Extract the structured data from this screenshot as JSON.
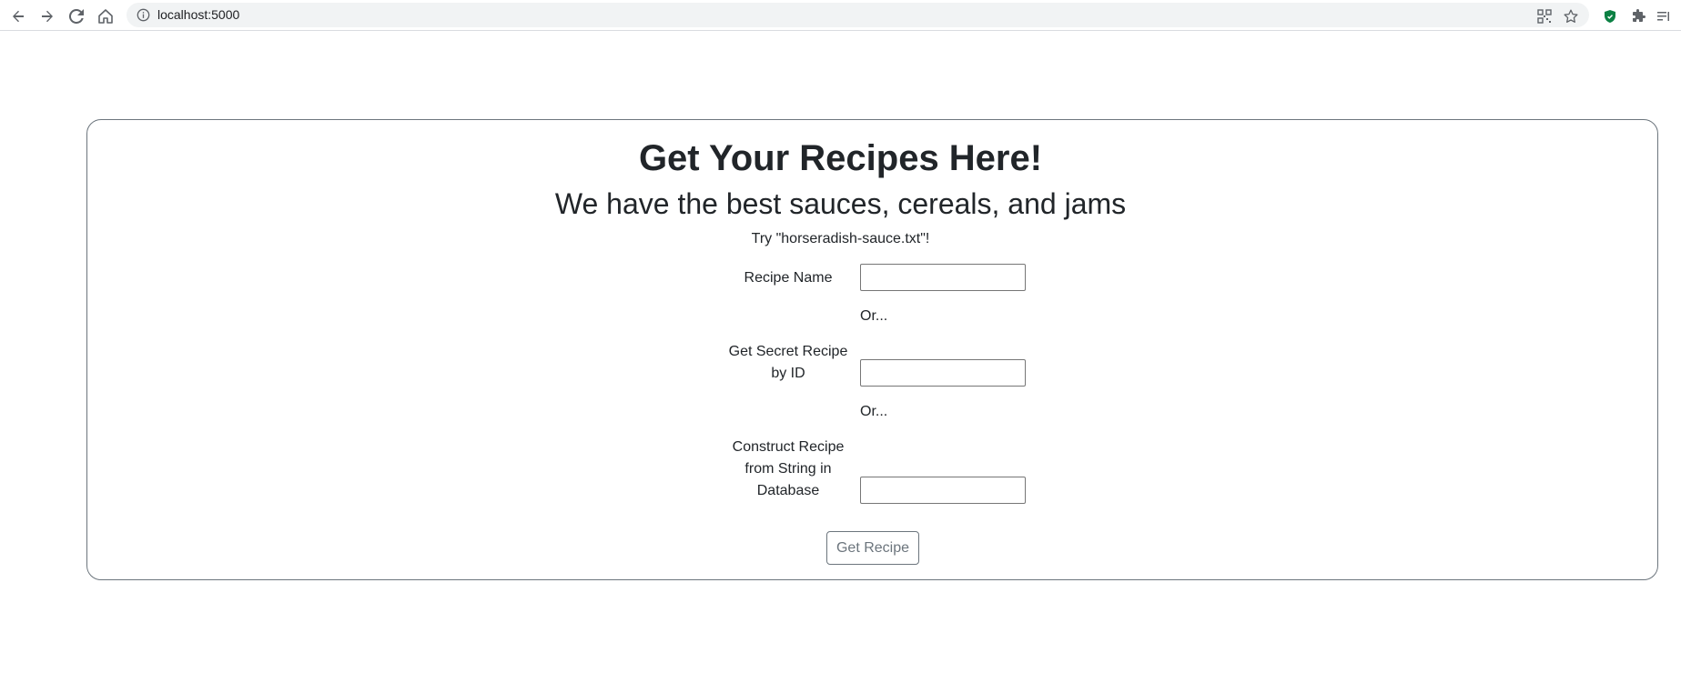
{
  "browser": {
    "url": "localhost:5000",
    "icons": {
      "back": "arrow-left-icon",
      "forward": "arrow-right-icon",
      "reload": "reload-icon",
      "home": "home-icon",
      "site_info": "info-icon",
      "qr": "qr-code-icon",
      "bookmark": "star-icon",
      "extension_shield": "shield-icon",
      "extensions": "puzzle-icon",
      "reading_list": "reading-list-icon"
    }
  },
  "page": {
    "title": "Get Your Recipes Here!",
    "subtitle": "We have the best sauces, cereals, and jams",
    "hint": "Try \"horseradish-sauce.txt\"!",
    "form": {
      "recipe_name_label": "Recipe Name",
      "recipe_name_value": "",
      "or_1": "Or...",
      "secret_id_label": "Get Secret Recipe by ID",
      "secret_id_value": "",
      "or_2": "Or...",
      "construct_label": "Construct Recipe from String in Database",
      "construct_value": "",
      "submit_label": "Get Recipe"
    }
  },
  "colors": {
    "text": "#212529",
    "muted": "#6c757d",
    "toolbar_bg": "#f1f3f4",
    "shield_green": "#0b8043"
  }
}
